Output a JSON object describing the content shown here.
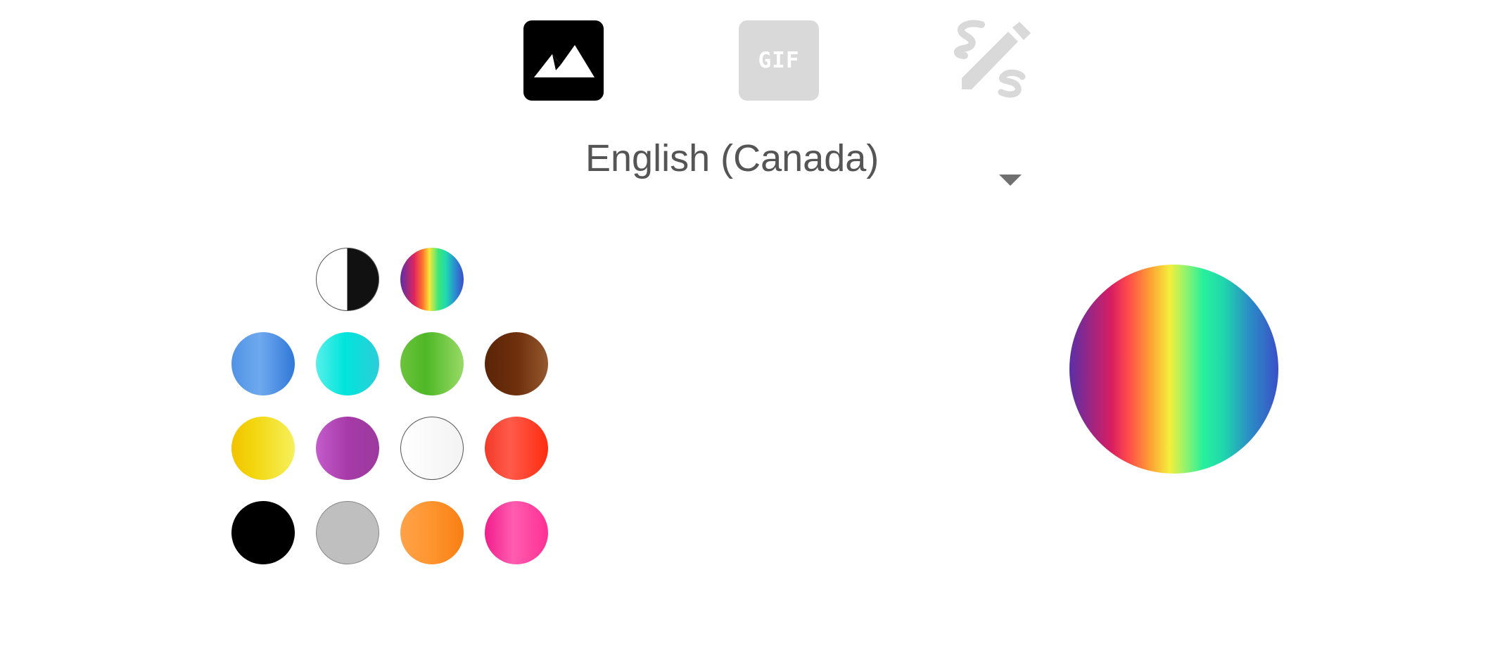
{
  "mode_tabs": [
    {
      "id": "image",
      "icon": "image-icon",
      "selected": true
    },
    {
      "id": "gif",
      "icon": "gif-icon",
      "label": "GIF",
      "selected": false
    },
    {
      "id": "draw",
      "icon": "handwriting-pencil-icon",
      "selected": false
    }
  ],
  "language": {
    "selected": "English (Canada)"
  },
  "swatches": [
    {
      "name": "black-white",
      "row": 0,
      "col": 1
    },
    {
      "name": "rainbow",
      "row": 0,
      "col": 2
    },
    {
      "name": "blue",
      "row": 1,
      "col": 0
    },
    {
      "name": "cyan",
      "row": 1,
      "col": 1
    },
    {
      "name": "green",
      "row": 1,
      "col": 2
    },
    {
      "name": "brown",
      "row": 1,
      "col": 3
    },
    {
      "name": "yellow",
      "row": 2,
      "col": 0
    },
    {
      "name": "purple",
      "row": 2,
      "col": 1
    },
    {
      "name": "white",
      "row": 2,
      "col": 2
    },
    {
      "name": "red",
      "row": 2,
      "col": 3
    },
    {
      "name": "black",
      "row": 3,
      "col": 0
    },
    {
      "name": "gray",
      "row": 3,
      "col": 1
    },
    {
      "name": "orange",
      "row": 3,
      "col": 2
    },
    {
      "name": "pink",
      "row": 3,
      "col": 3
    }
  ],
  "preview": {
    "selected_swatch": "rainbow"
  },
  "colors": {
    "tab_active": "#000000",
    "tab_inactive": "#d9d9d9",
    "text": "#555555",
    "dropdown_arrow": "#707070"
  }
}
